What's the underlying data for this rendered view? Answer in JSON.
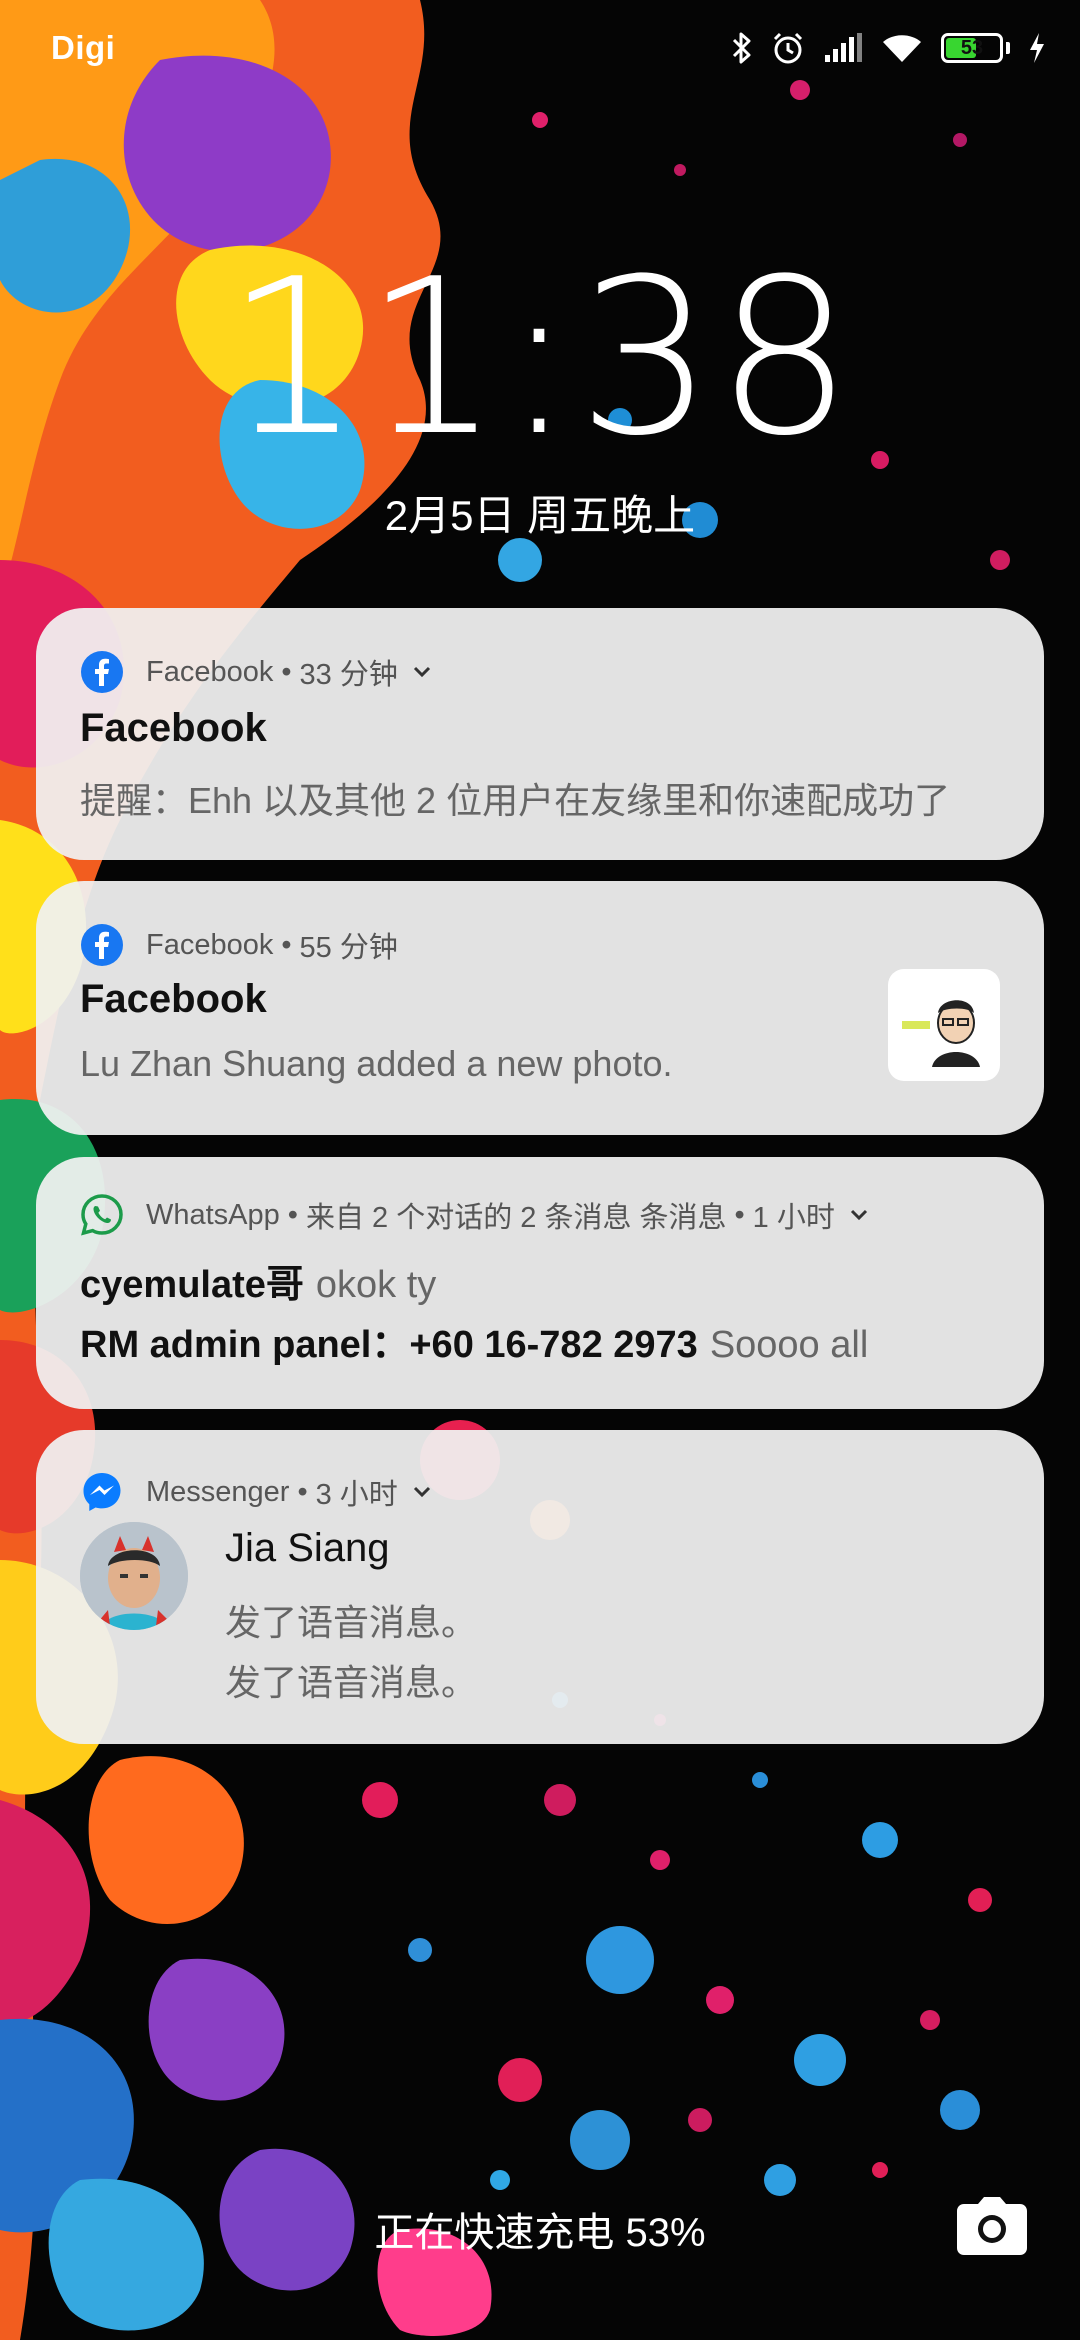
{
  "status_bar": {
    "carrier": "Digi",
    "battery_level": "53",
    "icons": [
      "bluetooth-icon",
      "alarm-icon",
      "signal-icon",
      "wifi-icon",
      "battery-icon",
      "charging-bolt-icon"
    ]
  },
  "lock_screen": {
    "time": "11:38",
    "date": "2月5日 周五晚上"
  },
  "notifications": [
    {
      "app": "Facebook",
      "time": "33 分钟",
      "title": "Facebook",
      "body": "提醒：Ehh 以及其他 2 位用户在友缘里和你速配成功了"
    },
    {
      "app": "Facebook",
      "time": "55 分钟",
      "title": "Facebook",
      "body": "Lu Zhan Shuang added a new photo."
    },
    {
      "app": "WhatsApp",
      "summary": "来自 2 个对话的 2 条消息 条消息",
      "time": "1 小时",
      "lines": [
        {
          "sender": "cyemulate哥",
          "message": "okok ty"
        },
        {
          "sender": "RM admin panel：+60 16-782 2973",
          "message": "Soooo all"
        }
      ]
    },
    {
      "app": "Messenger",
      "time": "3 小时",
      "title": "Jia Siang",
      "lines": [
        "发了语音消息。",
        "发了语音消息。"
      ]
    }
  ],
  "footer": {
    "charging_text": "正在快速充电 53%"
  },
  "colors": {
    "facebook_blue": "#1877f2",
    "whatsapp_green": "#1c9b4a",
    "messenger_blue": "#0a7cff",
    "battery_green": "#38d630"
  }
}
